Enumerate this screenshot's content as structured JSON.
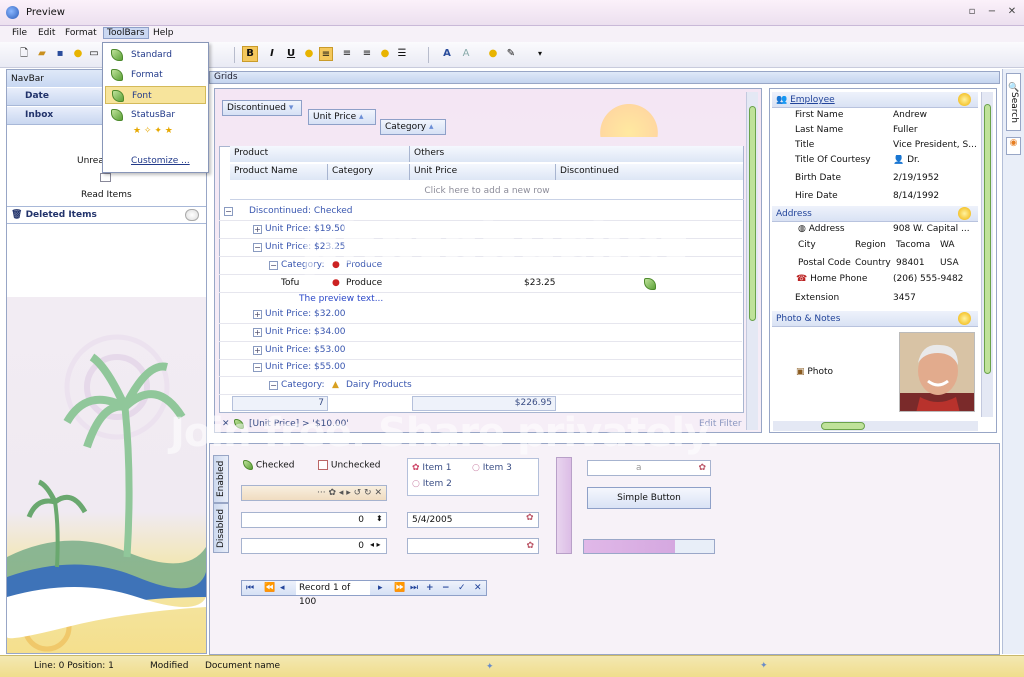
{
  "window": {
    "title": "Preview"
  },
  "menu": [
    "File",
    "Edit",
    "Format",
    "ToolBars",
    "Help"
  ],
  "toolbars_menu": {
    "items": [
      "Standard",
      "Format",
      "Font",
      "StatusBar"
    ],
    "customize": "Customize ..."
  },
  "navbar": {
    "header": "NavBar",
    "groups": [
      "Date",
      "Inbox"
    ],
    "unread_label": "Unrea",
    "read_items": "Read Items",
    "deleted_items": "Deleted Items"
  },
  "grids": {
    "title": "Grids",
    "group_panel": [
      "Discontinued",
      "Unit Price",
      "Category"
    ],
    "bands": [
      "Product",
      "Others"
    ],
    "columns": [
      "Product Name",
      "Category",
      "Unit Price",
      "Discontinued"
    ],
    "new_row": "Click here to add a new row",
    "rows": [
      {
        "indent": 0,
        "box": "−",
        "text": "Discontinued: Checked"
      },
      {
        "indent": 1,
        "box": "+",
        "text": "Unit Price: $19.50"
      },
      {
        "indent": 1,
        "box": "−",
        "text": "Unit Price: $23.25"
      },
      {
        "indent": 2,
        "box": "−",
        "text": "Category:",
        "extra": "Produce"
      },
      {
        "indent": 2,
        "box": "−",
        "text": "Category:",
        "extra": "Dairy Products"
      },
      {
        "indent": 1,
        "box": "+",
        "text": "Unit Price: $32.00"
      },
      {
        "indent": 1,
        "box": "+",
        "text": "Unit Price: $34.00"
      },
      {
        "indent": 1,
        "box": "+",
        "text": "Unit Price: $53.00"
      },
      {
        "indent": 1,
        "box": "−",
        "text": "Unit Price: $55.00"
      }
    ],
    "data_row": {
      "name": "Tofu",
      "category": "Produce",
      "price": "$23.25"
    },
    "preview_text": "The preview text...",
    "footer": {
      "count": "7",
      "sum": "$226.95"
    },
    "filter": "[Unit Price] > '$10.00'",
    "edit_filter": "Edit Filter"
  },
  "details": {
    "employee_section": "Employee",
    "fields": [
      {
        "label": "First Name",
        "value": "Andrew"
      },
      {
        "label": "Last Name",
        "value": "Fuller"
      },
      {
        "label": "Title",
        "value": "Vice President, S..."
      },
      {
        "label": "Title Of Courtesy",
        "value": "Dr."
      },
      {
        "label": "Birth Date",
        "value": "2/19/1952"
      },
      {
        "label": "Hire Date",
        "value": "8/14/1992"
      }
    ],
    "address_section": "Address",
    "address": {
      "label": "Address",
      "value": "908 W. Capital ...",
      "city_label": "City",
      "city": "Tacoma",
      "region_label": "Region",
      "region": "WA",
      "postal_label": "Postal Code",
      "postal": "98401",
      "country_label": "Country",
      "country": "USA",
      "phone_label": "Home Phone",
      "phone": "(206) 555-9482",
      "ext_label": "Extension",
      "ext": "3457"
    },
    "photo_section": "Photo & Notes",
    "photo_label": "Photo"
  },
  "editors": {
    "tabs": [
      "Enabled",
      "Disabled"
    ],
    "checked": "Checked",
    "unchecked": "Unchecked",
    "radios": [
      "Item 1",
      "Item 3",
      "Item 2"
    ],
    "spin1": "0",
    "spin2": "0",
    "date": "5/4/2005",
    "simple_button": "Simple Button",
    "record": "Record 1 of 100"
  },
  "rightbar": {
    "search": "Search"
  },
  "status": {
    "position": "Line: 0 Position: 1",
    "modified": "Modified",
    "docname": "Document name"
  },
  "watermark": [
    "photobucket",
    "Join free. Share privately."
  ]
}
